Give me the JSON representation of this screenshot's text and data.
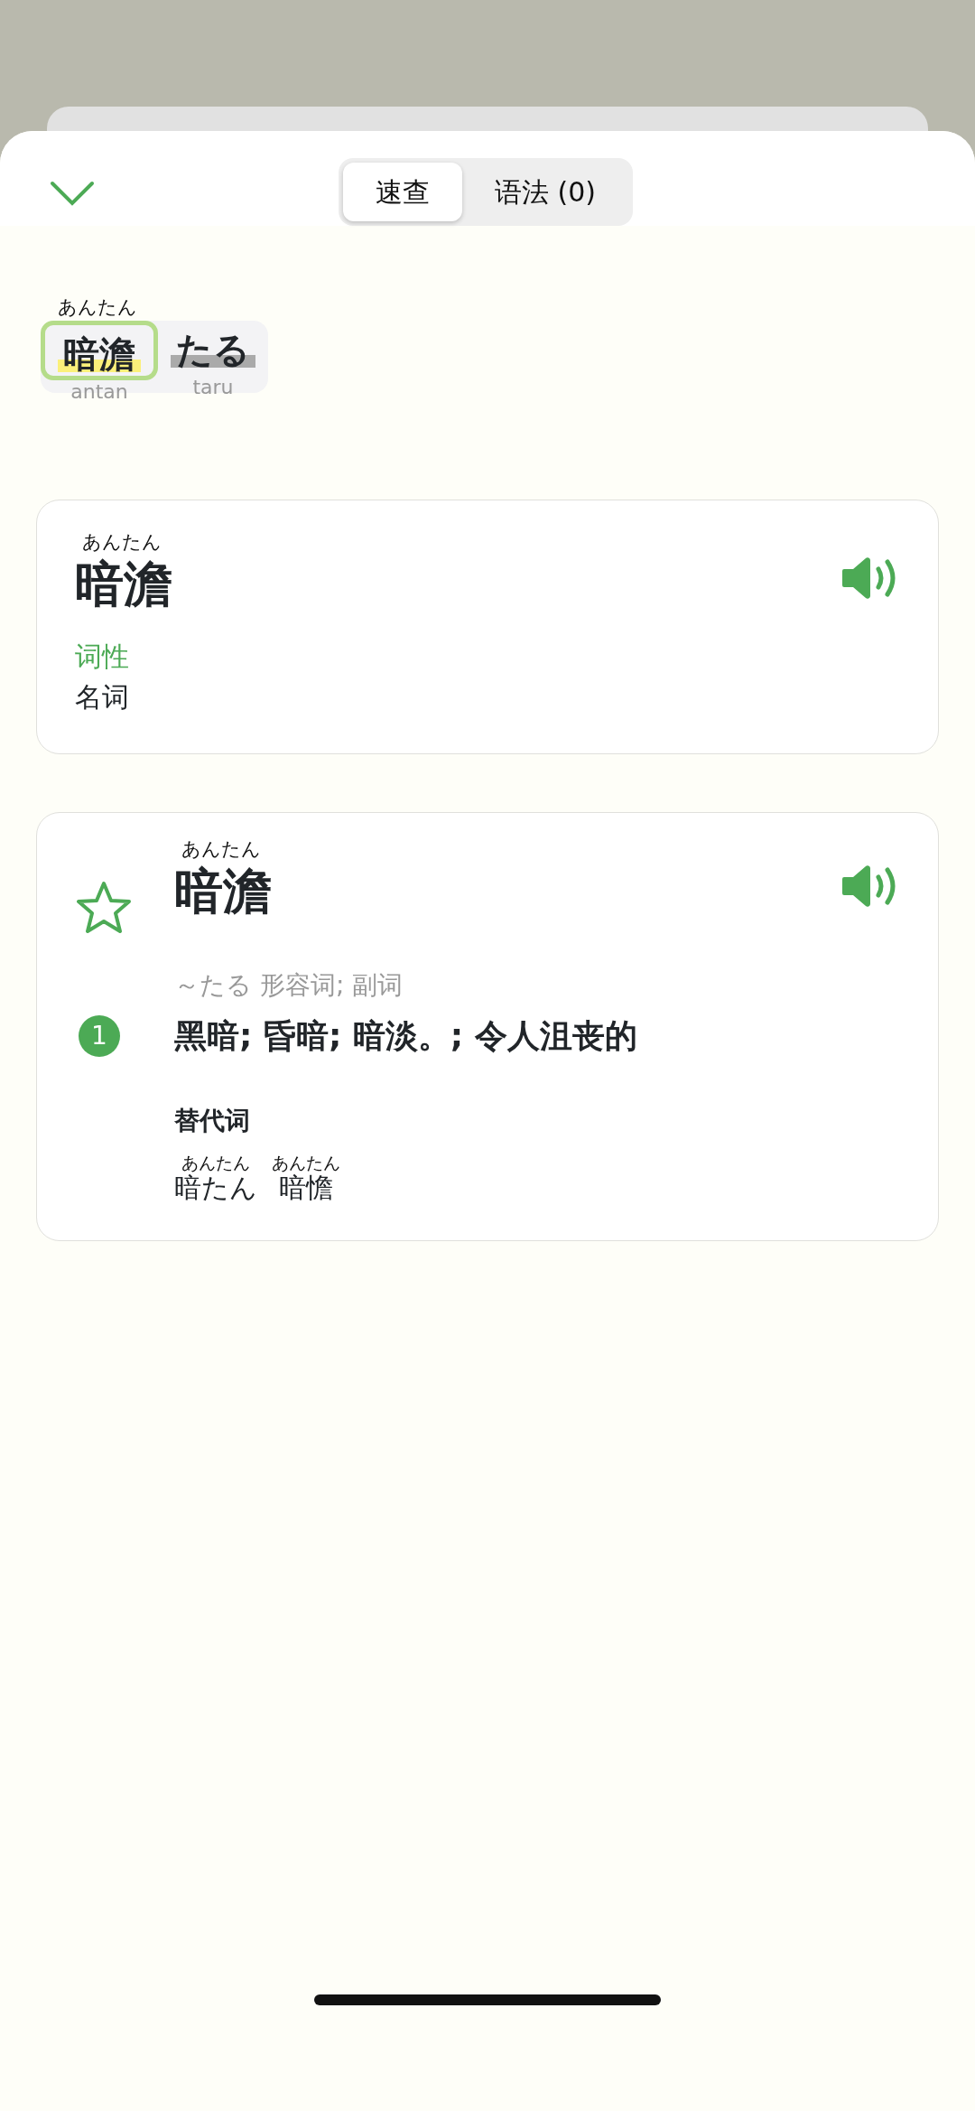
{
  "tabs": [
    {
      "label": "速查",
      "selected": true
    },
    {
      "label": "语法 (0)",
      "selected": false
    }
  ],
  "tokens": [
    {
      "reading": "あんたん",
      "word": "暗澹",
      "romaji": "antan",
      "selected": true,
      "color": "#fbf07a"
    },
    {
      "word": "たる",
      "romaji": "taru",
      "selected": false,
      "color": "#aaaaaa"
    }
  ],
  "summary_card": {
    "reading": "あんたん",
    "word": "暗澹",
    "pos_label": "词性",
    "pos": "名词"
  },
  "entry_card": {
    "starred": false,
    "reading": "あんたん",
    "word": "暗澹",
    "pos_line": "～たる 形容词; 副词",
    "senses": [
      {
        "number": "1",
        "text": "黑暗; 昏暗; 暗淡。; 令人沮丧的"
      }
    ],
    "alternatives_label": "替代词",
    "alternatives": [
      {
        "reading": "あんたん",
        "word": "暗たん"
      },
      {
        "reading": "あんたん",
        "word": "暗憺"
      }
    ]
  }
}
